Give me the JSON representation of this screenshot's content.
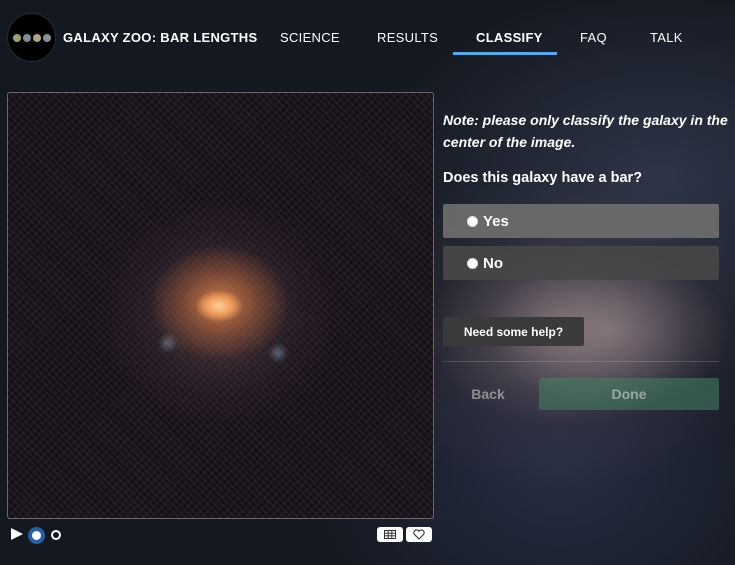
{
  "nav": {
    "brand": "GALAXY ZOO: BAR LENGTHS",
    "items": [
      {
        "label": "SCIENCE"
      },
      {
        "label": "RESULTS"
      },
      {
        "label": "CLASSIFY",
        "active": true
      },
      {
        "label": "FAQ"
      },
      {
        "label": "TALK"
      }
    ],
    "accent_color": "#5aa9e6"
  },
  "subject": {
    "frames_total": 2,
    "current_frame": 1
  },
  "task": {
    "note": "Note: please only classify the galaxy in the center of the image.",
    "question": "Does this galaxy have a bar?",
    "answers": [
      {
        "label": "Yes"
      },
      {
        "label": "No"
      }
    ],
    "help_label": "Need some help?",
    "back_label": "Back",
    "done_label": "Done"
  },
  "icons": {
    "play": "play-icon",
    "metadata": "grid-icon",
    "favorite": "heart-icon"
  }
}
